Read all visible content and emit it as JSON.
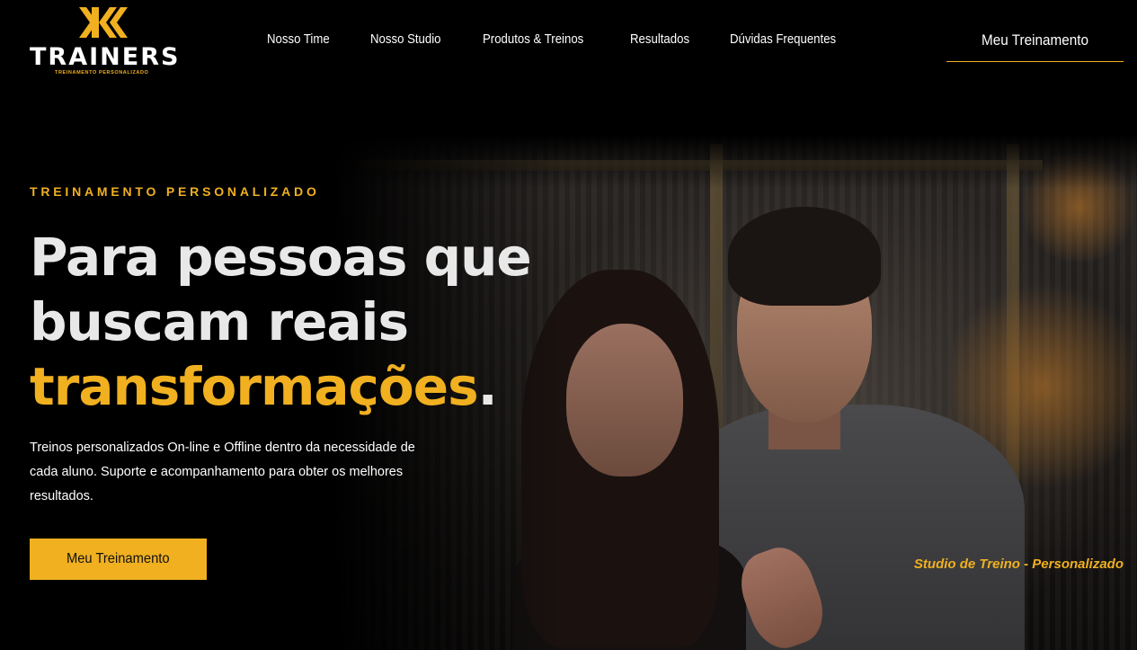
{
  "header": {
    "logo": {
      "wordmark": "TRAINERS",
      "tagline": "TREINAMENTO PERSONALIZADO",
      "brand_color": "#f0b020"
    },
    "nav": [
      {
        "label": "Nosso Time"
      },
      {
        "label": "Nosso Studio"
      },
      {
        "label": "Produtos & Treinos"
      },
      {
        "label": "Resultados"
      },
      {
        "label": "Dúvidas Frequentes"
      }
    ],
    "cta_label": "Meu Treinamento"
  },
  "hero": {
    "eyebrow": "TREINAMENTO PERSONALIZADO",
    "headline_line1": "Para pessoas que",
    "headline_line2": "buscam reais",
    "headline_accent": "transformações",
    "headline_end": ".",
    "description": "Treinos personalizados On-line e Offline dentro da necessidade de cada aluno. Suporte e acompanhamento para obter os melhores resultados.",
    "button_label": "Meu Treinamento",
    "photo_caption": "Studio de Treino - Personalizado",
    "photo_icon": "couple-photo"
  },
  "colors": {
    "accent": "#f0b020",
    "background": "#000000",
    "text": "#ffffff"
  }
}
